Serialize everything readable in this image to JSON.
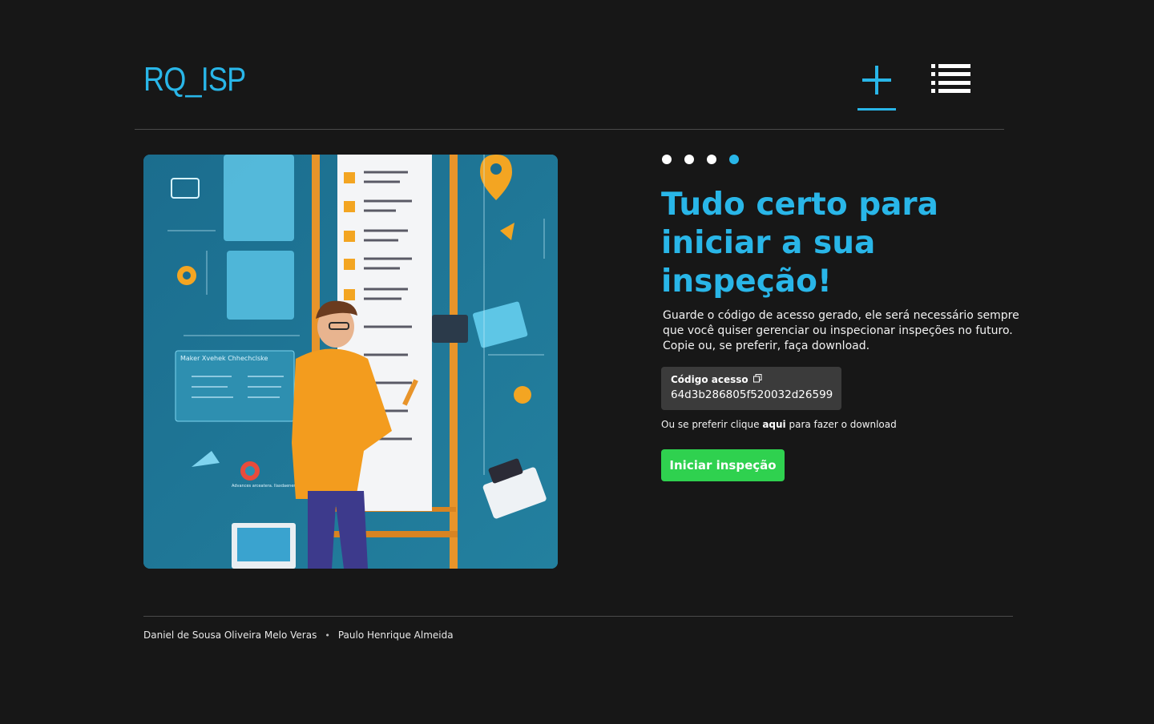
{
  "header": {
    "logo": "RQ_ISP"
  },
  "hero": {
    "image_text": "Maker Xvehek Chhechclske",
    "image_caption_small": "Advances arceatera. Ilaxdaenercaf"
  },
  "steps": {
    "total": 4,
    "current": 4
  },
  "main": {
    "title": "Tudo certo para iniciar a sua inspeção!",
    "description": "Guarde o código de acesso gerado, ele será necessário sempre que você quiser gerenciar ou inspecionar inspeções no futuro. Copie ou, se preferir, faça download.",
    "code_label": "Código acesso",
    "code_value": "64d3b286805f520032d26599",
    "download_prefix": "Ou se preferir clique",
    "download_link": "aqui",
    "download_suffix": "para fazer o download",
    "start_button": "Iniciar inspeção"
  },
  "footer": {
    "authors": [
      "Daniel de Sousa Oliveira Melo Veras",
      "Paulo Henrique Almeida"
    ],
    "separator": "•"
  },
  "colors": {
    "background": "#171717",
    "accent": "#29b6e8",
    "button": "#2fd14f",
    "code_box": "#3b3b3b"
  }
}
